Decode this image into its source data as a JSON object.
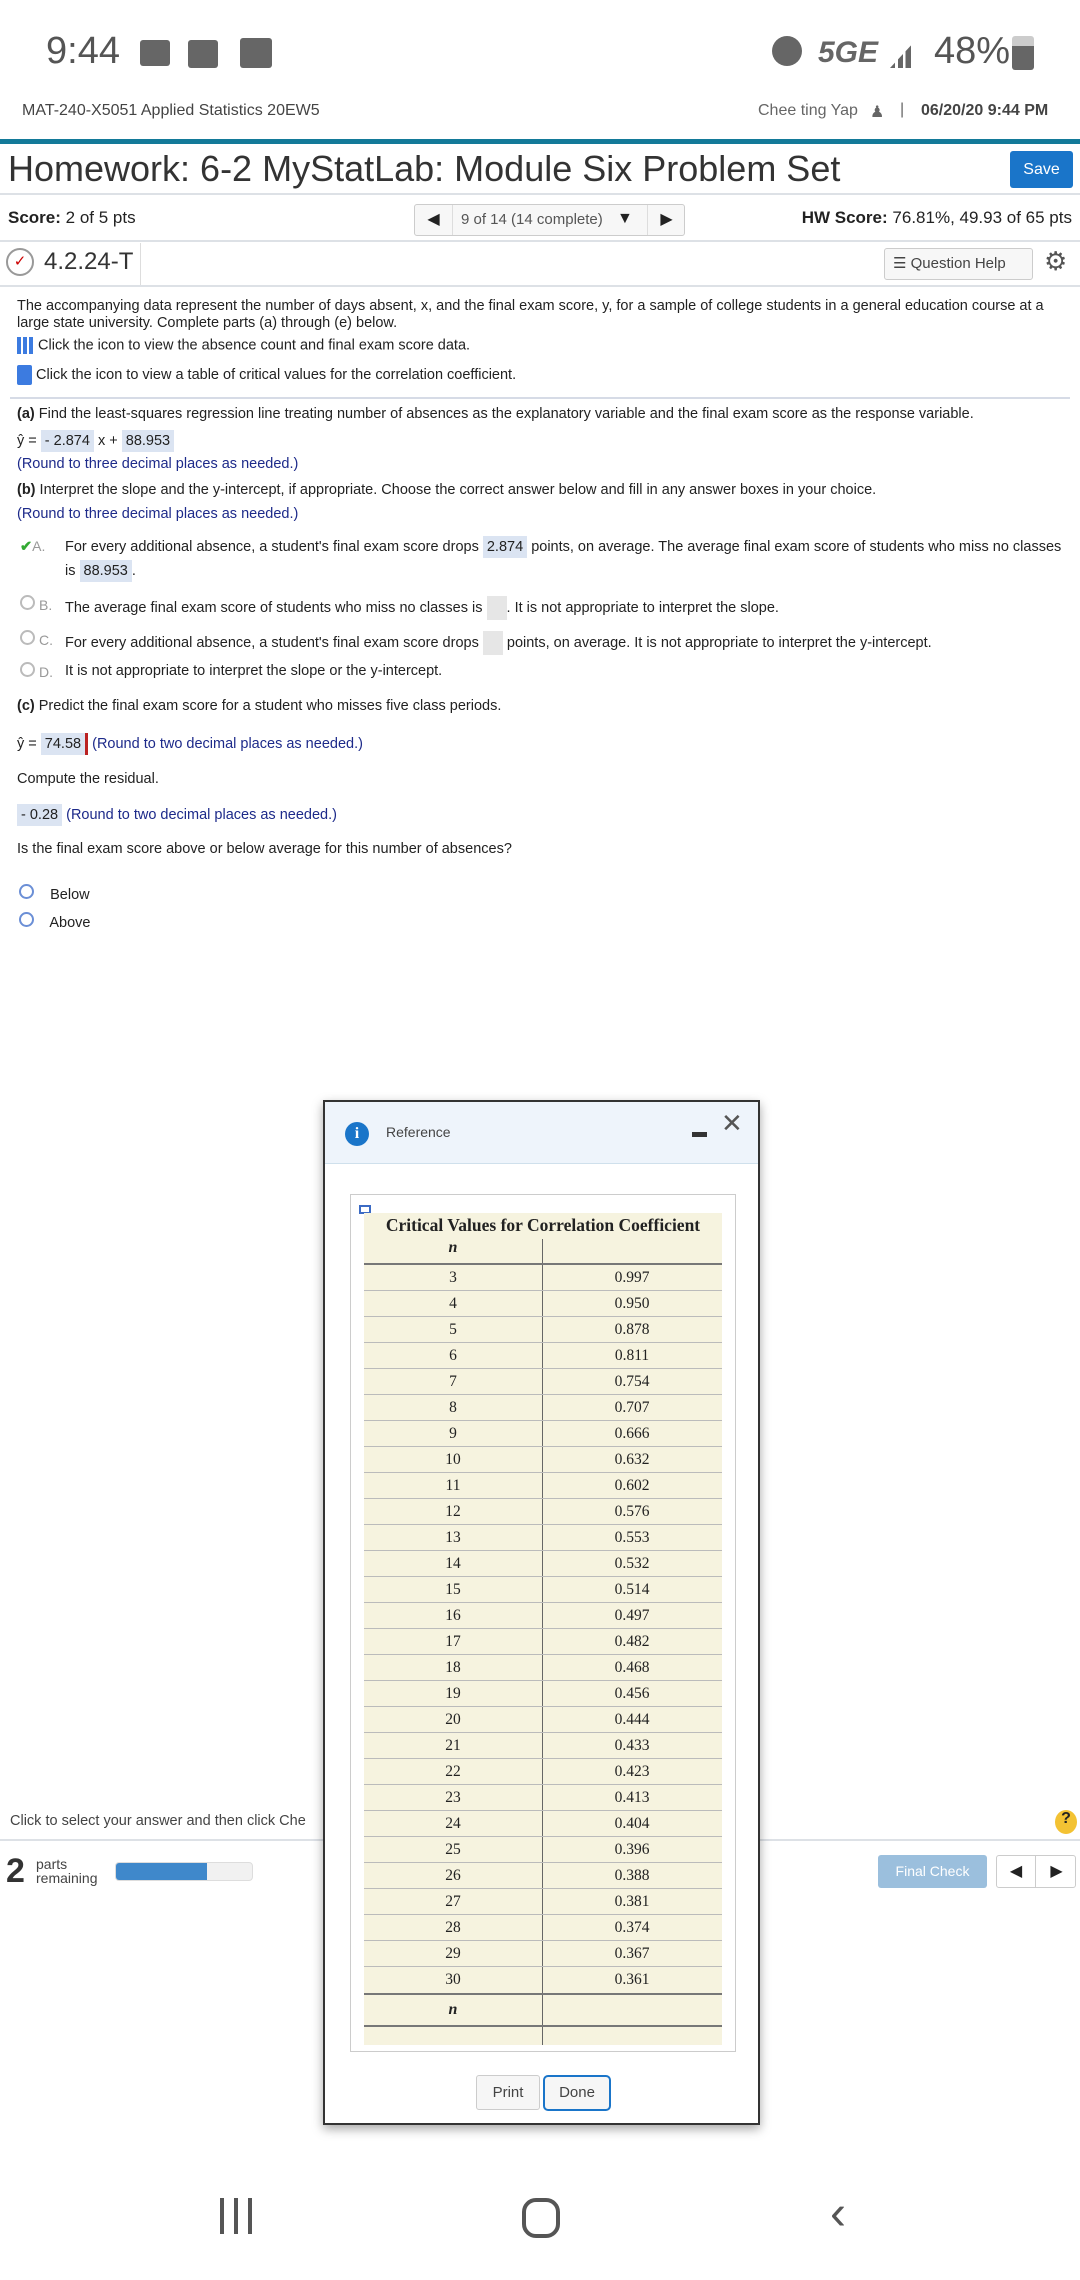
{
  "status_bar": {
    "time": "9:44",
    "network": "5GE",
    "battery": "48%",
    "icons": [
      "mail-icon",
      "download-icon",
      "image-icon",
      "alarm-icon",
      "signal-icon",
      "battery-charging-icon"
    ]
  },
  "header": {
    "course": "MAT-240-X5051 Applied Statistics 20EW5",
    "user": "Chee ting Yap",
    "datetime": "06/20/20 9:44 PM",
    "title": "Homework: 6-2 MyStatLab: Module Six Problem Set",
    "save_label": "Save",
    "accent": "#137a99"
  },
  "score": {
    "label": "Score:",
    "value": "2 of 5 pts",
    "pager": "9 of 14 (14 complete)",
    "hw_label": "HW Score:",
    "hw_value": "76.81%, 49.93 of 65 pts"
  },
  "question": {
    "id": "4.2.24-T",
    "help_label": "Question Help",
    "intro": "The accompanying data represent the number of days absent, x, and the final exam score, y, for a sample of college students in a general education course at a large state university. Complete parts (a) through (e) below.",
    "data_link": "Click the icon to view the absence count and final exam score data.",
    "table_link": "Click the icon to view a table of critical values for the correlation coefficient.",
    "a_label": "(a)",
    "a_text": " Find the least-squares regression line treating number of absences as the explanatory variable and the final exam score as the response variable.",
    "yhat": "ŷ =",
    "slope": "- 2.874",
    "x_plus": "x +",
    "intercept": "88.953",
    "round3": "(Round to three decimal places as needed.)",
    "b_label": "(b)",
    "b_text": " Interpret the slope and the y-intercept, if appropriate. Choose the correct answer below and fill in any answer boxes in your choice.",
    "options": [
      {
        "letter": "A.",
        "pre": "For every additional absence, a student's final exam score drops",
        "val1": "2.874",
        "mid": "points, on average. The average final exam score of students who miss no classes",
        "line2pre": "is",
        "val2": "88.953",
        "post": "."
      },
      {
        "letter": "B.",
        "pre": "The average final exam score of students who miss no classes is",
        "post": ". It is not appropriate to interpret the slope."
      },
      {
        "letter": "C.",
        "pre": "For every additional absence, a student's final exam score drops",
        "post": "points, on average. It is not appropriate to interpret the y-intercept."
      },
      {
        "letter": "D.",
        "pre": "It is not appropriate to interpret the slope or the y-intercept."
      }
    ],
    "c_label": "(c)",
    "c_text": " Predict the final exam score for a student who misses five class periods.",
    "prediction": "74.58",
    "round2": "(Round to two decimal places as needed.)",
    "residual_prompt": "Compute the residual.",
    "residual": "- 0.28",
    "above_below": "Is the final exam score above or below average for this number of absences?",
    "choices": [
      "Below",
      "Above"
    ]
  },
  "footer": {
    "instruction": "Click to select your answer and then click Che",
    "parts_count": "2",
    "parts_label1": "parts",
    "parts_label2": "remaining",
    "progress": 0.67,
    "final_check": "Final Check"
  },
  "dialog": {
    "title": "Reference",
    "table_title": "Critical Values for Correlation Coefficient",
    "col_n": "n",
    "print": "Print",
    "done": "Done",
    "rows": [
      [
        "3",
        "0.997"
      ],
      [
        "4",
        "0.950"
      ],
      [
        "5",
        "0.878"
      ],
      [
        "6",
        "0.811"
      ],
      [
        "7",
        "0.754"
      ],
      [
        "8",
        "0.707"
      ],
      [
        "9",
        "0.666"
      ],
      [
        "10",
        "0.632"
      ],
      [
        "11",
        "0.602"
      ],
      [
        "12",
        "0.576"
      ],
      [
        "13",
        "0.553"
      ],
      [
        "14",
        "0.532"
      ],
      [
        "15",
        "0.514"
      ],
      [
        "16",
        "0.497"
      ],
      [
        "17",
        "0.482"
      ],
      [
        "18",
        "0.468"
      ],
      [
        "19",
        "0.456"
      ],
      [
        "20",
        "0.444"
      ],
      [
        "21",
        "0.433"
      ],
      [
        "22",
        "0.423"
      ],
      [
        "23",
        "0.413"
      ],
      [
        "24",
        "0.404"
      ],
      [
        "25",
        "0.396"
      ],
      [
        "26",
        "0.388"
      ],
      [
        "27",
        "0.381"
      ],
      [
        "28",
        "0.374"
      ],
      [
        "29",
        "0.367"
      ],
      [
        "30",
        "0.361"
      ]
    ]
  }
}
